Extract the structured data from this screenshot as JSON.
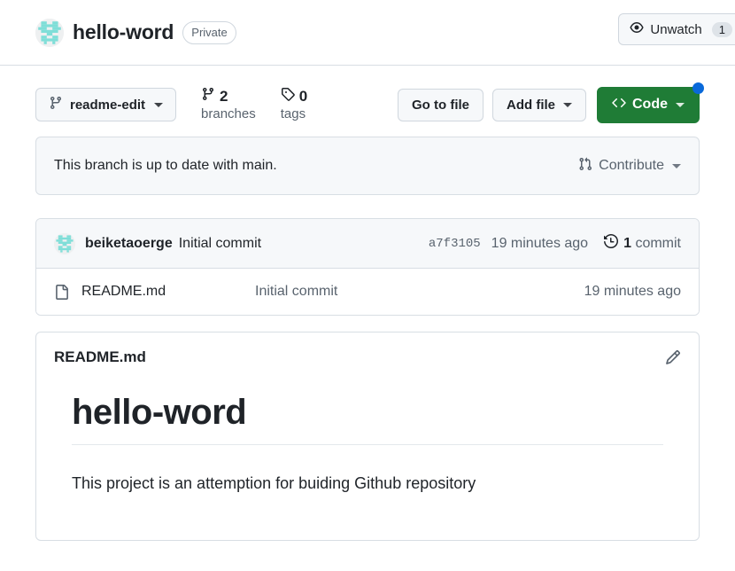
{
  "header": {
    "repo_name": "hello-word",
    "visibility_badge": "Private",
    "watch_label": "Unwatch",
    "watch_count": "1",
    "avatar_icon": "identicon-avatar",
    "eye_icon": "eye-icon"
  },
  "toolbar": {
    "branch_name": "readme-edit",
    "branch_icon": "git-branch-icon",
    "branches_count": "2",
    "branches_label": "branches",
    "tags_count": "0",
    "tags_label": "tags",
    "tag_icon": "tag-icon",
    "go_to_file": "Go to file",
    "add_file": "Add file",
    "code_label": "Code",
    "code_icon": "code-brackets-icon",
    "code_accent_color": "#1f7c36",
    "notification_dot_color": "#0969da"
  },
  "branch_status": {
    "message": "This branch is up to date with main.",
    "contribute_label": "Contribute",
    "contribute_icon": "git-pull-request-icon"
  },
  "commit": {
    "author": "beiketaoerge",
    "message": "Initial commit",
    "sha": "a7f3105",
    "time": "19 minutes ago",
    "count": "1",
    "count_label": "commit",
    "history_icon": "history-clock-icon"
  },
  "files": [
    {
      "name": "README.md",
      "commit_message": "Initial commit",
      "time": "19 minutes ago",
      "icon": "file-icon"
    }
  ],
  "readme": {
    "panel_title": "README.md",
    "edit_icon": "pencil-icon",
    "heading": "hello-word",
    "paragraph": "This project is an attemption for buiding Github repository"
  }
}
